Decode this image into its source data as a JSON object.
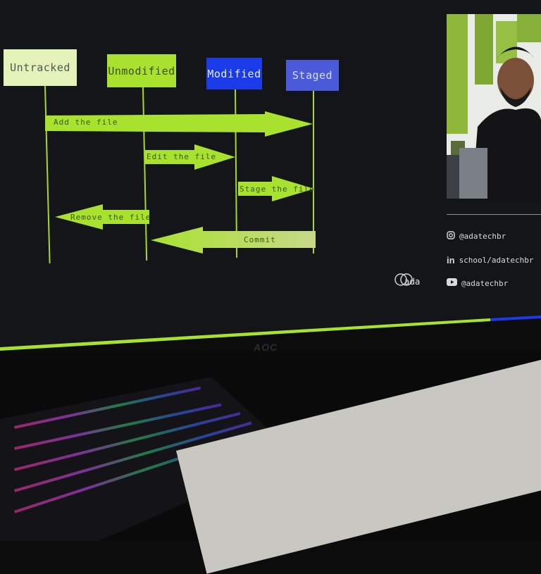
{
  "diagram": {
    "states": [
      {
        "label": "Untracked"
      },
      {
        "label": "Unmodified"
      },
      {
        "label": "Modified"
      },
      {
        "label": "Staged"
      }
    ],
    "transitions": [
      {
        "label": "Add the file"
      },
      {
        "label": "Edit the file"
      },
      {
        "label": "Stage the file"
      },
      {
        "label": "Remove the file"
      },
      {
        "label": "Commit"
      }
    ]
  },
  "sidebar": {
    "socials": [
      {
        "icon": "instagram-icon",
        "text": "@adatechbr"
      },
      {
        "icon": "linkedin-icon",
        "text": "school/adatechbr"
      },
      {
        "icon": "youtube-icon",
        "text": "@adatechbr"
      }
    ],
    "brand": "ada"
  },
  "monitor": {
    "logo": "AOC"
  },
  "colors": {
    "lime": "#a8e22f",
    "pale_green": "#e3f2b8",
    "blue": "#1b3ae8",
    "steel_blue": "#4a5ad8",
    "screen_bg": "#131518"
  }
}
